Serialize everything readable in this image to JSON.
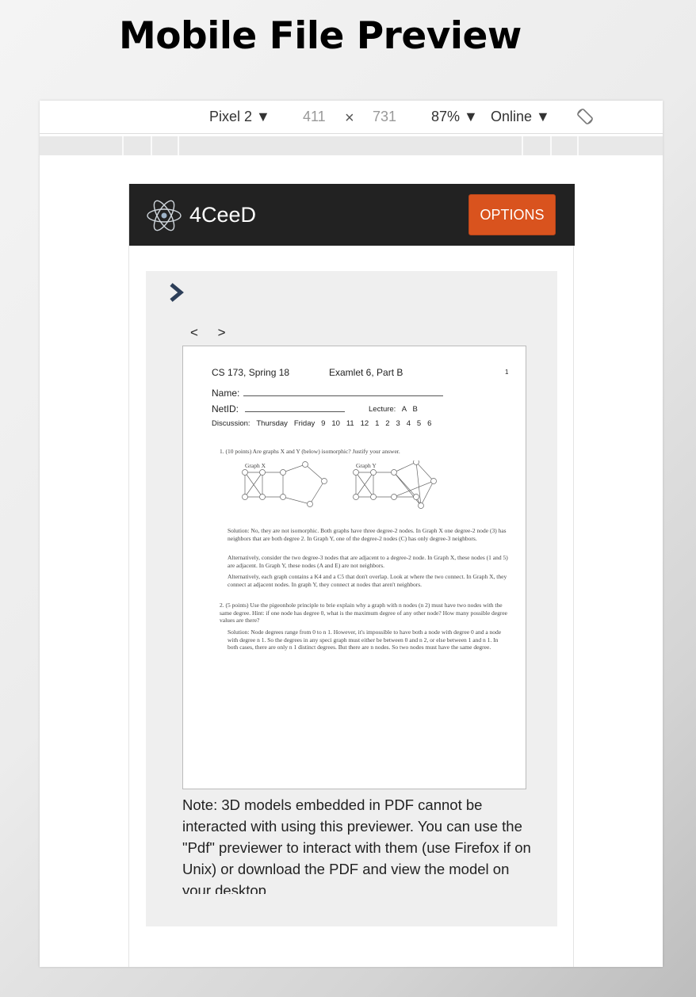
{
  "slide": {
    "title": "Mobile File Preview"
  },
  "devtools": {
    "device": "Pixel 2 ▼",
    "width": "411",
    "times": "×",
    "height": "731",
    "zoom": "87% ▼",
    "network": "Online ▼",
    "rotate_icon": "rotate-icon"
  },
  "app": {
    "brand": "4CeeD",
    "options_label": "OPTIONS",
    "colors": {
      "navbar": "#222222",
      "accent": "#d9531e"
    }
  },
  "viewer": {
    "prev": "<",
    "next": ">",
    "doc": {
      "course": "CS 173, Spring 18",
      "exam": "Examlet 6, Part B",
      "page_num": "1",
      "name_label": "Name:",
      "netid_label": "NetID:",
      "lecture": "Lecture:   A   B",
      "discussion": "Discussion:   Thursday   Friday   9   10   11   12   1   2   3   4   5   6",
      "q1": "1. (10 points)   Are graphs X and Y (below) isomorphic? Justify your answer.",
      "graph_x": "Graph X",
      "graph_y": "Graph Y",
      "s1": "Solution: No, they are not isomorphic. Both graphs have three degree-2 nodes. In Graph X one degree-2 node (3) has neighbors that are both degree 2. In Graph Y, one of the degree-2 nodes (C) has only degree-3 neighbors.",
      "s2": "Alternatively, consider the two degree-3 nodes that are adjacent to a degree-2 node. In Graph X, these nodes (1 and 5) are adjacent. In Graph Y, these nodes (A and E) are not neighbors.",
      "s3": "Alternatively, each graph contains a K4 and a C5 that don't overlap. Look at where the two connect. In Graph X, they connect at adjacent nodes. In graph Y, they connect at nodes that aren't neighbors.",
      "q2": "2. (5 points)  Use the pigeonhole principle to brie explain why a graph with n nodes (n 2) must have two nodes with the same degree. Hint: if one node has degree 0, what is the maximum degree of any other node? How many possible degree values are there?",
      "s4": "Solution: Node degrees range from 0 to n 1. However, it's impossible to have both a node with degree 0 and a node with degree n 1. So the degrees in any speci graph must either be between 0 and n 2, or else between 1 and n 1. In both cases, there are only n 1 distinct degrees. But there are n nodes. So two nodes must have the same degree."
    },
    "note": "Note: 3D models embedded in PDF cannot be interacted with using this previewer. You can use the \"Pdf\" previewer to interact with them (use Firefox if on Unix) or download the PDF and view the model on your desktop."
  }
}
